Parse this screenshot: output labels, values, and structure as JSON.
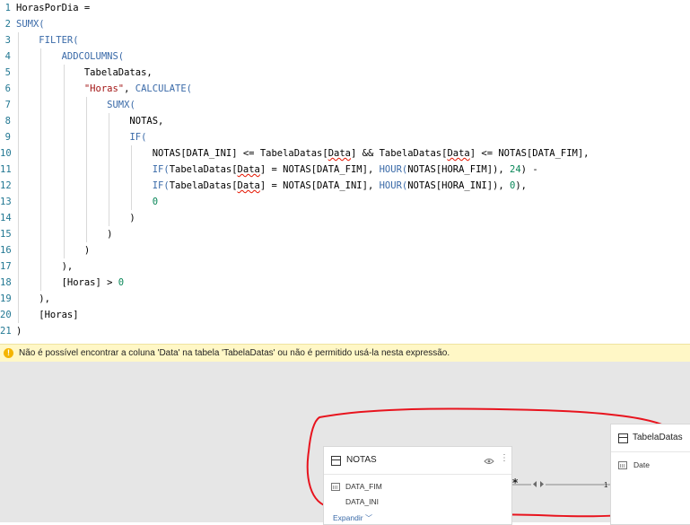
{
  "editor": {
    "lines": [
      {
        "n": "1",
        "tokens": [
          {
            "t": "HorasPorDia =",
            "c": ""
          }
        ]
      },
      {
        "n": "2",
        "tokens": [
          {
            "t": "SUMX(",
            "c": "fn"
          }
        ]
      },
      {
        "n": "3",
        "tokens": [
          {
            "t": "    ",
            "c": ""
          },
          {
            "t": "FILTER(",
            "c": "fn"
          }
        ]
      },
      {
        "n": "4",
        "tokens": [
          {
            "t": "        ",
            "c": ""
          },
          {
            "t": "ADDCOLUMNS(",
            "c": "fn"
          }
        ]
      },
      {
        "n": "5",
        "tokens": [
          {
            "t": "            TabelaDatas,",
            "c": ""
          }
        ]
      },
      {
        "n": "6",
        "tokens": [
          {
            "t": "            ",
            "c": ""
          },
          {
            "t": "\"Horas\"",
            "c": "str"
          },
          {
            "t": ", ",
            "c": ""
          },
          {
            "t": "CALCULATE(",
            "c": "fn"
          }
        ]
      },
      {
        "n": "7",
        "tokens": [
          {
            "t": "                ",
            "c": ""
          },
          {
            "t": "SUMX(",
            "c": "fn"
          }
        ]
      },
      {
        "n": "8",
        "tokens": [
          {
            "t": "                    NOTAS,",
            "c": ""
          }
        ]
      },
      {
        "n": "9",
        "tokens": [
          {
            "t": "                    ",
            "c": ""
          },
          {
            "t": "IF(",
            "c": "fn"
          }
        ]
      },
      {
        "n": "10",
        "tokens": [
          {
            "t": "                        NOTAS[DATA_INI] <= TabelaDatas[",
            "c": ""
          },
          {
            "t": "Data",
            "c": "squig"
          },
          {
            "t": "] && TabelaDatas[",
            "c": ""
          },
          {
            "t": "Data",
            "c": "squig"
          },
          {
            "t": "] <= NOTAS[DATA_FIM],",
            "c": ""
          }
        ]
      },
      {
        "n": "11",
        "tokens": [
          {
            "t": "                        ",
            "c": ""
          },
          {
            "t": "IF(",
            "c": "fn"
          },
          {
            "t": "TabelaDatas[",
            "c": ""
          },
          {
            "t": "Data",
            "c": "squig"
          },
          {
            "t": "] = NOTAS[DATA_FIM], ",
            "c": ""
          },
          {
            "t": "HOUR(",
            "c": "fn"
          },
          {
            "t": "NOTAS[HORA_FIM]), ",
            "c": ""
          },
          {
            "t": "24",
            "c": "num"
          },
          {
            "t": ") -",
            "c": ""
          }
        ]
      },
      {
        "n": "12",
        "tokens": [
          {
            "t": "                        ",
            "c": ""
          },
          {
            "t": "IF(",
            "c": "fn"
          },
          {
            "t": "TabelaDatas[",
            "c": ""
          },
          {
            "t": "Data",
            "c": "squig"
          },
          {
            "t": "] = NOTAS[DATA_INI], ",
            "c": ""
          },
          {
            "t": "HOUR(",
            "c": "fn"
          },
          {
            "t": "NOTAS[HORA_INI]), ",
            "c": ""
          },
          {
            "t": "0",
            "c": "num"
          },
          {
            "t": "),",
            "c": ""
          }
        ]
      },
      {
        "n": "13",
        "tokens": [
          {
            "t": "                        ",
            "c": ""
          },
          {
            "t": "0",
            "c": "num"
          }
        ]
      },
      {
        "n": "14",
        "tokens": [
          {
            "t": "                    )",
            "c": ""
          }
        ]
      },
      {
        "n": "15",
        "tokens": [
          {
            "t": "                )",
            "c": ""
          }
        ]
      },
      {
        "n": "16",
        "tokens": [
          {
            "t": "            )",
            "c": ""
          }
        ]
      },
      {
        "n": "17",
        "tokens": [
          {
            "t": "        ),",
            "c": ""
          }
        ]
      },
      {
        "n": "18",
        "tokens": [
          {
            "t": "        [Horas] > ",
            "c": ""
          },
          {
            "t": "0",
            "c": "num"
          }
        ]
      },
      {
        "n": "19",
        "tokens": [
          {
            "t": "    ),",
            "c": ""
          }
        ]
      },
      {
        "n": "20",
        "tokens": [
          {
            "t": "    [Horas]",
            "c": ""
          }
        ]
      },
      {
        "n": "21",
        "tokens": [
          {
            "t": ")",
            "c": ""
          }
        ]
      }
    ]
  },
  "error": {
    "message": "Não é possível encontrar a coluna 'Data' na tabela 'TabelaDatas' ou não é permitido usá-la nesta expressão.",
    "icon": "warning-icon",
    "icon_glyph": "!"
  },
  "model": {
    "notas": {
      "title": "NOTAS",
      "fields": [
        "DATA_FIM",
        "DATA_INI"
      ],
      "expand_label": "Expandir"
    },
    "tabela_datas": {
      "title": "TabelaDatas",
      "fields": [
        "Date"
      ]
    },
    "relationship": {
      "from_cardinality": "*",
      "to_cardinality": "1"
    },
    "annotation_color": "#e8141e"
  }
}
